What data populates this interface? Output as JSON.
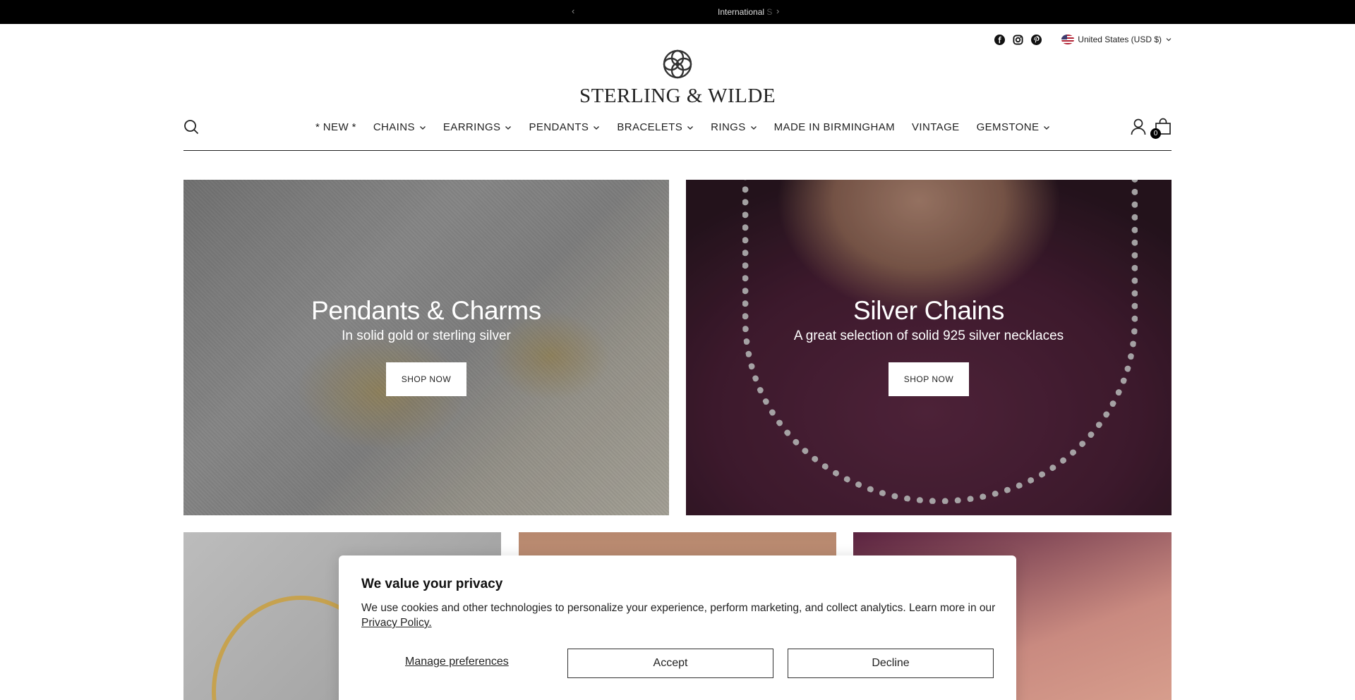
{
  "announcement": {
    "message": "International",
    "message_fade": " S"
  },
  "utility": {
    "social_icons": [
      "facebook-icon",
      "instagram-icon",
      "pinterest-icon"
    ],
    "country": "United States (USD $)"
  },
  "brand": {
    "name": "STERLING & WILDE"
  },
  "nav": {
    "items": [
      {
        "label": "* NEW *",
        "dropdown": false
      },
      {
        "label": "CHAINS",
        "dropdown": true
      },
      {
        "label": "EARRINGS",
        "dropdown": true
      },
      {
        "label": "PENDANTS",
        "dropdown": true
      },
      {
        "label": "BRACELETS",
        "dropdown": true
      },
      {
        "label": "RINGS",
        "dropdown": true
      },
      {
        "label": "MADE IN BIRMINGHAM",
        "dropdown": false
      },
      {
        "label": "VINTAGE",
        "dropdown": false
      },
      {
        "label": "GEMSTONE",
        "dropdown": true
      }
    ],
    "cart_count": "0"
  },
  "tiles": [
    {
      "title": "Pendants & Charms",
      "subtitle": "In solid gold or sterling silver",
      "cta": "SHOP NOW"
    },
    {
      "title": "Silver Chains",
      "subtitle": "A great selection of solid 925 silver necklaces",
      "cta": "SHOP NOW"
    }
  ],
  "cookie": {
    "title": "We value your privacy",
    "body": "We use cookies and other technologies to personalize your experience, perform marketing, and collect analytics. Learn more in our ",
    "link": "Privacy Policy.",
    "manage": "Manage preferences",
    "accept": "Accept",
    "decline": "Decline"
  },
  "colors": {
    "announcement_bg": "#000000",
    "text": "#1a1a1a",
    "button_bg": "#ffffff"
  }
}
